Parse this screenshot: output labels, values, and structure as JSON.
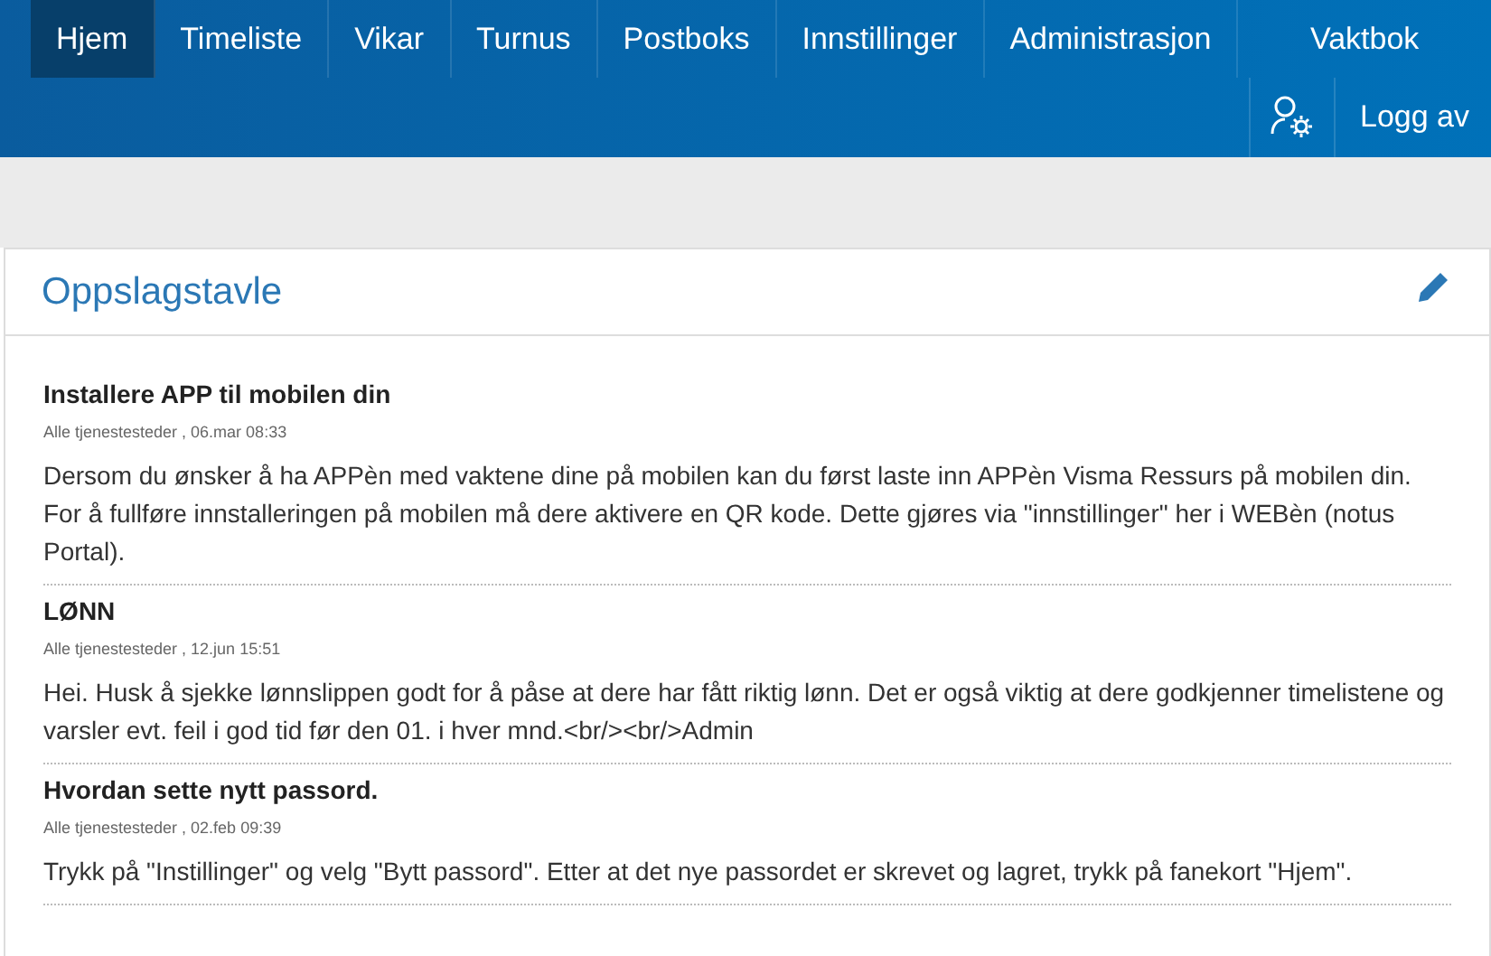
{
  "nav": {
    "tabs": [
      {
        "label": "Hjem",
        "selected": true
      },
      {
        "label": "Timeliste",
        "selected": false
      },
      {
        "label": "Vikar",
        "selected": false
      },
      {
        "label": "Turnus",
        "selected": false
      },
      {
        "label": "Postboks",
        "selected": false
      },
      {
        "label": "Innstillinger",
        "selected": false
      },
      {
        "label": "Administrasjon",
        "selected": false
      },
      {
        "label": "Vaktbok",
        "selected": false
      }
    ],
    "logout": "Logg av"
  },
  "board": {
    "title": "Oppslagstavle",
    "posts": [
      {
        "title": "Installere APP til mobilen din",
        "meta": "Alle tjenestesteder , 06.mar 08:33",
        "body": "Dersom du ønsker å ha APPèn med vaktene dine på mobilen kan du først laste inn APPèn Visma Ressurs på mobilen din. For å fullføre innstalleringen på mobilen må dere aktivere en QR kode. Dette gjøres via \"innstillinger\" her i WEBèn (notus Portal)."
      },
      {
        "title": "LØNN",
        "meta": "Alle tjenestesteder , 12.jun 15:51",
        "body": "Hei. Husk å sjekke lønnslippen godt for å påse at dere har fått riktig lønn. Det er også viktig at dere godkjenner timelistene og varsler evt. feil i god tid før den 01. i hver mnd.<br/><br/>Admin"
      },
      {
        "title": "Hvordan sette nytt passord.",
        "meta": "Alle tjenestesteder , 02.feb 09:39",
        "body": "Trykk på \"Instillinger\" og velg \"Bytt passord\". Etter at det nye passordet er skrevet og lagret, trykk på fanekort \"Hjem\"."
      }
    ]
  }
}
